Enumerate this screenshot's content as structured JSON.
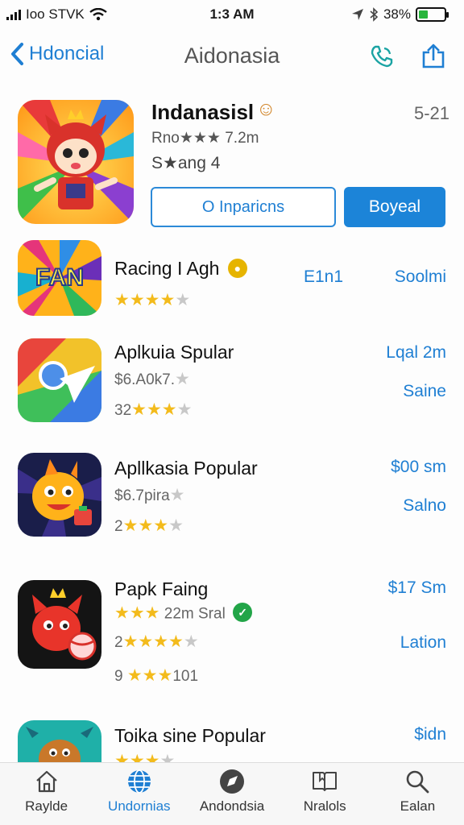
{
  "status_bar": {
    "carrier": "Ioo STVK",
    "time": "1:3 AM",
    "battery": "38%",
    "battery_level": 0.38
  },
  "nav": {
    "back_label": "Hdoncial",
    "title": "Aidonasia"
  },
  "featured": {
    "name": "Indanasisl",
    "count": "5-21",
    "subtitle": "Rno★★★ 7.2m",
    "subtitle2": "S★ang 4",
    "button_outline": "O Inparicns",
    "button_fill": "Boyeal"
  },
  "list": [
    {
      "name": "Racing I Agh",
      "rating": 4,
      "right_top": "E1n1",
      "right_bottom": "Soolmi"
    },
    {
      "name": "Aplkuia Spular",
      "sub1": "$6.A0k7.",
      "sub2": "32",
      "rating": 4,
      "right_top": "Lqal 2m",
      "right_bottom": "Saine"
    },
    {
      "name": "Apllkasia Popular",
      "sub1": "$6.7pira",
      "sub2": "2",
      "rating": 3,
      "right_top": "$00 sm",
      "right_bottom": "Salno"
    },
    {
      "name": "Papk Faing",
      "sub1": "22m Sral",
      "sub2": "2",
      "sub3_prefix": "9",
      "sub3_suffix": "101",
      "rating": 4,
      "right_top": "$17 Sm",
      "right_bottom": "Lation"
    },
    {
      "name": "Toika sine Popular",
      "rating": 3,
      "right_top": "$idn"
    }
  ],
  "tabs": [
    {
      "label": "Raylde",
      "icon": "home-icon"
    },
    {
      "label": "Undornias",
      "icon": "globe-icon"
    },
    {
      "label": "Andondsia",
      "icon": "compass-icon"
    },
    {
      "label": "Nralols",
      "icon": "book-icon"
    },
    {
      "label": "Ealan",
      "icon": "search-icon"
    }
  ],
  "colors": {
    "accent": "#1f7fd3",
    "star": "#f3bb1c",
    "badge_yellow": "#e6b400",
    "badge_green": "#22a548"
  }
}
